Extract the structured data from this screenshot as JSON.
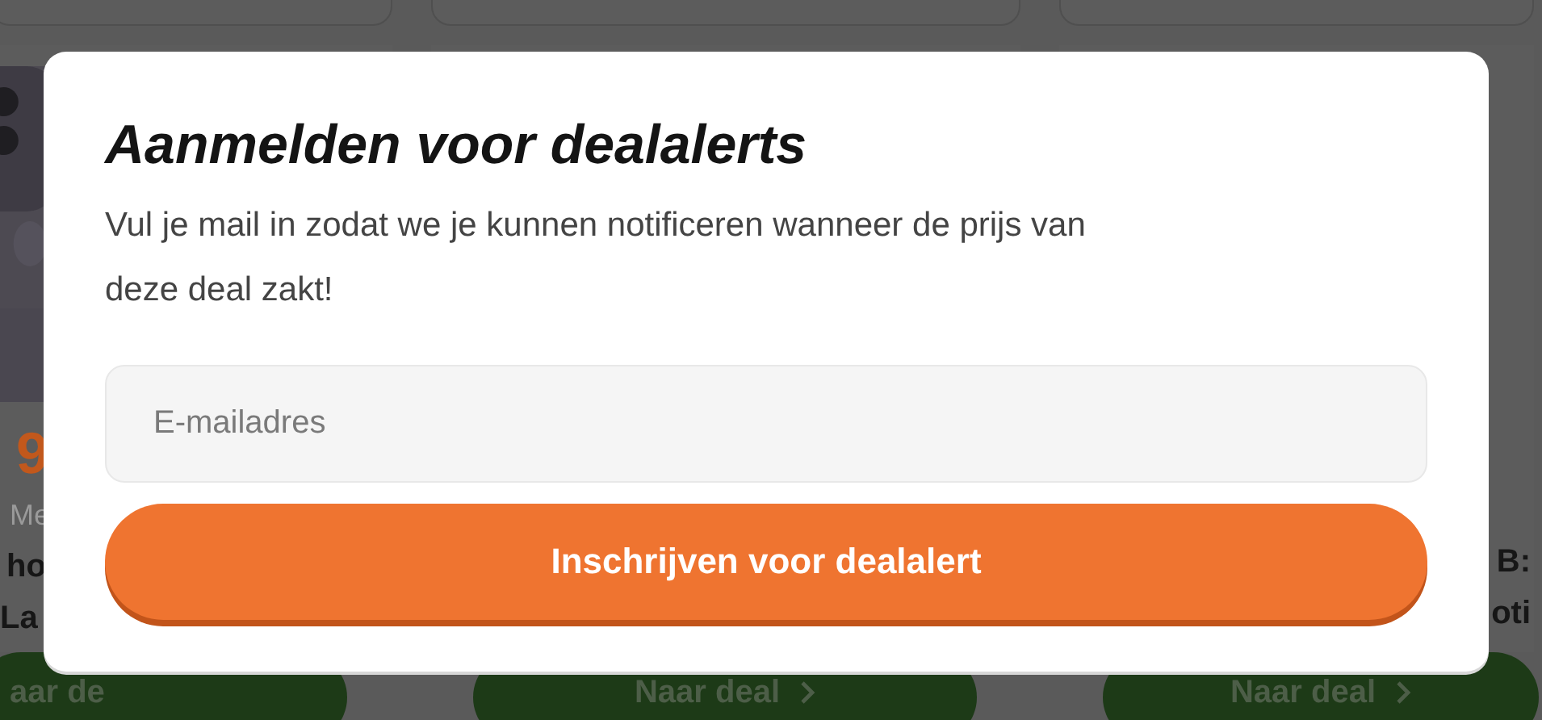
{
  "background_cards": [
    {
      "price": "9",
      "subtitle": "Me",
      "title_lines": [
        "ho",
        "La"
      ],
      "button": "aar de",
      "chevron": false
    },
    {
      "kind": "plain",
      "button": "Naar deal",
      "chevron": true
    },
    {
      "kind": "text",
      "title_lines": [
        "B:",
        "oti"
      ],
      "button": "Naar deal",
      "chevron": true
    }
  ],
  "modal": {
    "title": "Aanmelden voor dealalerts",
    "text": "Vul je mail in zodat we je kunnen notificeren wanneer de prijs van deze deal zakt!",
    "email": {
      "placeholder": "E-mailadres"
    },
    "submit": "Inschrijven voor dealalert"
  }
}
